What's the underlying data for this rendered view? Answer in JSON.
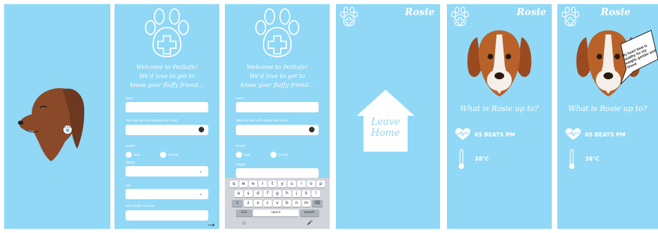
{
  "colors": {
    "background": "#90d8f6",
    "accent": "#ffffff",
    "dog_brown": "#8a4a2a"
  },
  "screen2": {
    "welcome_line1": "Welcome to PetSafe!",
    "welcome_line2": "We'd love to get to",
    "welcome_line3": "know your fluffy friend...",
    "name_label": "Name",
    "breed_label": "Take a pic and we'll analyse their breed",
    "gender_label": "Gender",
    "male_label": "Male",
    "female_label": "Female",
    "weight_label": "Weight",
    "age_label": "Age",
    "concerns_label": "Other health concerns",
    "next_arrow": "→"
  },
  "screen3": {
    "welcome_line1": "Welcome to PetSafe!",
    "welcome_line2": "We'd love to get to",
    "welcome_line3": "know your fluffy friend...",
    "name_label": "Name",
    "breed_label": "Take a pic and we'll analyse their breed",
    "gender_label": "Gender",
    "male_label": "Male",
    "female_label": "Female",
    "weight_label": "Weight",
    "keyboard": {
      "row1": [
        "q",
        "w",
        "e",
        "r",
        "t",
        "y",
        "u",
        "i",
        "o",
        "p"
      ],
      "row2": [
        "a",
        "s",
        "d",
        "f",
        "g",
        "h",
        "j",
        "k",
        "l"
      ],
      "row3": [
        "z",
        "x",
        "c",
        "v",
        "b",
        "n",
        "m"
      ],
      "shift": "⇧",
      "backspace": "⌫",
      "numbers": "123",
      "space": "space",
      "search": "search",
      "emoji": "☺",
      "mic": "🎤"
    }
  },
  "screen4": {
    "pet_name": "Rosie",
    "leave_home_line1": "Leave",
    "leave_home_line2": "Home"
  },
  "screen5": {
    "pet_name": "Rosie",
    "question": "What is Rosie up to?",
    "heart_rate": "65 BEATS PM",
    "temperature": "38°C"
  },
  "screen6": {
    "pet_name": "Rosie",
    "question": "What is Rosie up to?",
    "heart_rate": "65 BEATS PM",
    "temperature": "38°C",
    "speech_bubble": "My heart beat is healthy for my weight, gender and breed."
  }
}
